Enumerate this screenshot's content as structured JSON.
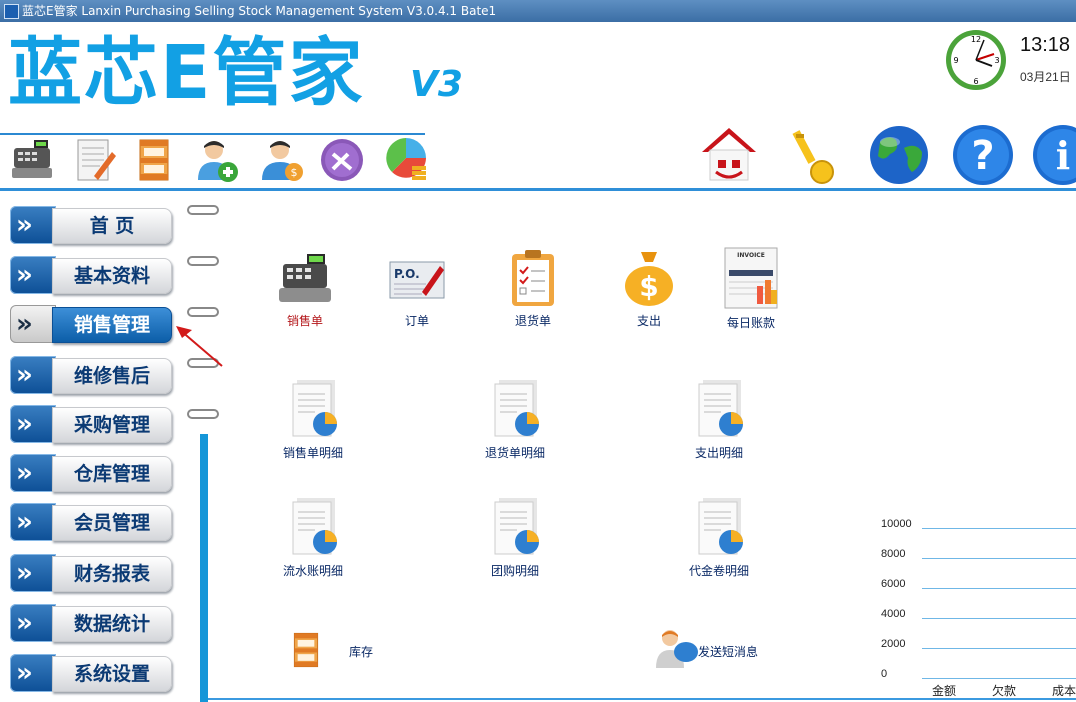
{
  "window": {
    "title": "蓝芯E管家 Lanxin Purchasing Selling Stock Management System V3.0.4.1 Bate1"
  },
  "logo": {
    "text": "蓝芯E管家",
    "version": "V3"
  },
  "clock": {
    "time": "13:18",
    "date": "03月21日"
  },
  "toolbar": {
    "small_icons": [
      "cash-register-icon",
      "edit-document-icon",
      "storage-box-icon",
      "add-user-icon",
      "user-money-icon",
      "tools-icon",
      "pie-coins-icon"
    ],
    "big_icons": [
      "home-icon",
      "key-icon",
      "globe-icon",
      "help-icon",
      "info-icon"
    ]
  },
  "sidebar": {
    "items": [
      {
        "label": "首  页",
        "active": false
      },
      {
        "label": "基本资料",
        "active": false
      },
      {
        "label": "销售管理",
        "active": true
      },
      {
        "label": "维修售后",
        "active": false
      },
      {
        "label": "采购管理",
        "active": false
      },
      {
        "label": "仓库管理",
        "active": false
      },
      {
        "label": "会员管理",
        "active": false
      },
      {
        "label": "财务报表",
        "active": false
      },
      {
        "label": "数据统计",
        "active": false
      },
      {
        "label": "系统设置",
        "active": false
      }
    ]
  },
  "main": {
    "row1": [
      {
        "label": "销售单",
        "icon": "cash-register-icon"
      },
      {
        "label": "订单",
        "icon": "purchase-order-icon"
      },
      {
        "label": "退货单",
        "icon": "clipboard-checklist-icon"
      },
      {
        "label": "支出",
        "icon": "money-bag-icon"
      },
      {
        "label": "每日账款",
        "icon": "invoice-icon"
      }
    ],
    "row2": [
      {
        "label": "销售单明细",
        "icon": "report-icon"
      },
      {
        "label": "退货单明细",
        "icon": "report-icon"
      },
      {
        "label": "支出明细",
        "icon": "report-icon"
      }
    ],
    "row3": [
      {
        "label": "流水账明细",
        "icon": "report-icon"
      },
      {
        "label": "团购明细",
        "icon": "report-icon"
      },
      {
        "label": "代金卷明细",
        "icon": "report-icon"
      }
    ],
    "row4": [
      {
        "label": "库存",
        "icon": "storage-box-icon"
      },
      {
        "label": "发送短消息",
        "icon": "users-message-icon"
      }
    ]
  },
  "mini_chart": {
    "yticks": [
      "10000",
      "8000",
      "6000",
      "4000",
      "2000",
      "0"
    ],
    "xlabels": [
      "金额",
      "欠款",
      "成本"
    ]
  }
}
